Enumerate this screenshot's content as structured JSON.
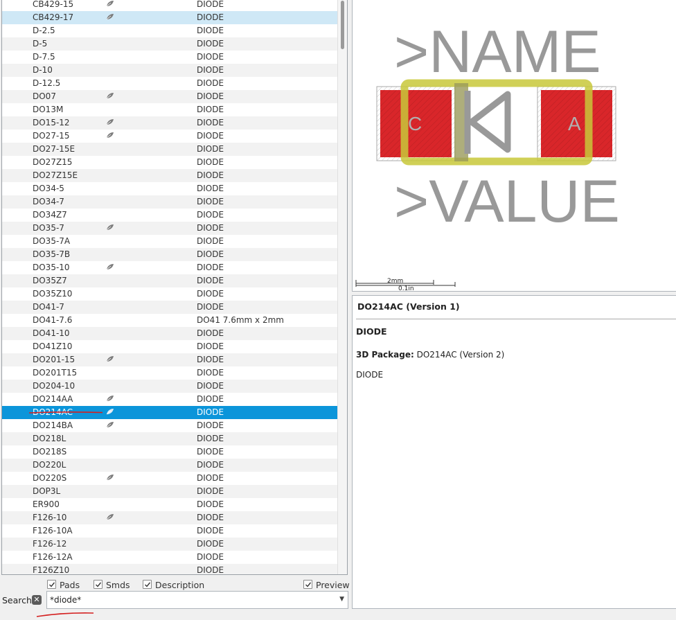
{
  "list": {
    "rows": [
      {
        "name": "CB429-15",
        "desc": "DIODE",
        "model3d": true
      },
      {
        "name": "CB429-17",
        "desc": "DIODE",
        "model3d": true,
        "hover": true
      },
      {
        "name": "D-2.5",
        "desc": "DIODE",
        "model3d": false
      },
      {
        "name": "D-5",
        "desc": "DIODE",
        "model3d": false
      },
      {
        "name": "D-7.5",
        "desc": "DIODE",
        "model3d": false
      },
      {
        "name": "D-10",
        "desc": "DIODE",
        "model3d": false
      },
      {
        "name": "D-12.5",
        "desc": "DIODE",
        "model3d": false
      },
      {
        "name": "DO07",
        "desc": "DIODE",
        "model3d": true
      },
      {
        "name": "DO13M",
        "desc": "DIODE",
        "model3d": false
      },
      {
        "name": "DO15-12",
        "desc": "DIODE",
        "model3d": true
      },
      {
        "name": "DO27-15",
        "desc": "DIODE",
        "model3d": true
      },
      {
        "name": "DO27-15E",
        "desc": "DIODE",
        "model3d": false
      },
      {
        "name": "DO27Z15",
        "desc": "DIODE",
        "model3d": false
      },
      {
        "name": "DO27Z15E",
        "desc": "DIODE",
        "model3d": false
      },
      {
        "name": "DO34-5",
        "desc": "DIODE",
        "model3d": false
      },
      {
        "name": "DO34-7",
        "desc": "DIODE",
        "model3d": false
      },
      {
        "name": "DO34Z7",
        "desc": "DIODE",
        "model3d": false
      },
      {
        "name": "DO35-7",
        "desc": "DIODE",
        "model3d": true
      },
      {
        "name": "DO35-7A",
        "desc": "DIODE",
        "model3d": false
      },
      {
        "name": "DO35-7B",
        "desc": "DIODE",
        "model3d": false
      },
      {
        "name": "DO35-10",
        "desc": "DIODE",
        "model3d": true
      },
      {
        "name": "DO35Z7",
        "desc": "DIODE",
        "model3d": false
      },
      {
        "name": "DO35Z10",
        "desc": "DIODE",
        "model3d": false
      },
      {
        "name": "DO41-7",
        "desc": "DIODE",
        "model3d": false
      },
      {
        "name": "DO41-7.6",
        "desc": "DO41 7.6mm x 2mm",
        "model3d": false
      },
      {
        "name": "DO41-10",
        "desc": "DIODE",
        "model3d": false
      },
      {
        "name": "DO41Z10",
        "desc": "DIODE",
        "model3d": false
      },
      {
        "name": "DO201-15",
        "desc": "DIODE",
        "model3d": true
      },
      {
        "name": "DO201T15",
        "desc": "DIODE",
        "model3d": false
      },
      {
        "name": "DO204-10",
        "desc": "DIODE",
        "model3d": false
      },
      {
        "name": "DO214AA",
        "desc": "DIODE",
        "model3d": true
      },
      {
        "name": "DO214AC",
        "desc": "DIODE",
        "model3d": true,
        "selected": true
      },
      {
        "name": "DO214BA",
        "desc": "DIODE",
        "model3d": true
      },
      {
        "name": "DO218L",
        "desc": "DIODE",
        "model3d": false
      },
      {
        "name": "DO218S",
        "desc": "DIODE",
        "model3d": false
      },
      {
        "name": "DO220L",
        "desc": "DIODE",
        "model3d": false
      },
      {
        "name": "DO220S",
        "desc": "DIODE",
        "model3d": true
      },
      {
        "name": "DOP3L",
        "desc": "DIODE",
        "model3d": false
      },
      {
        "name": "ER900",
        "desc": "DIODE",
        "model3d": false
      },
      {
        "name": "F126-10",
        "desc": "DIODE",
        "model3d": true
      },
      {
        "name": "F126-10A",
        "desc": "DIODE",
        "model3d": false
      },
      {
        "name": "F126-12",
        "desc": "DIODE",
        "model3d": false
      },
      {
        "name": "F126-12A",
        "desc": "DIODE",
        "model3d": false
      },
      {
        "name": "F126Z10",
        "desc": "DIODE",
        "model3d": false
      }
    ]
  },
  "preview": {
    "name_label": ">NAME",
    "value_label": ">VALUE",
    "pad_left": "C",
    "pad_right": "A",
    "scale_mm": "2mm",
    "scale_in": "0.1in",
    "colors": {
      "pad": "#d9262a",
      "silk": "#c8c83a",
      "text": "#999999"
    }
  },
  "description": {
    "title": "DO214AC (Version 1)",
    "heading": "DIODE",
    "pkg_label": "3D Package:",
    "pkg_value": "DO214AC (Version 2)",
    "body": "DIODE"
  },
  "filters": {
    "pads": "Pads",
    "smds": "Smds",
    "description": "Description",
    "preview": "Preview"
  },
  "search": {
    "label": "Search",
    "value": "*diode*"
  },
  "colors": {
    "selection": "#0b95da",
    "hover": "#cfe8f6",
    "annotation": "#d42020"
  }
}
